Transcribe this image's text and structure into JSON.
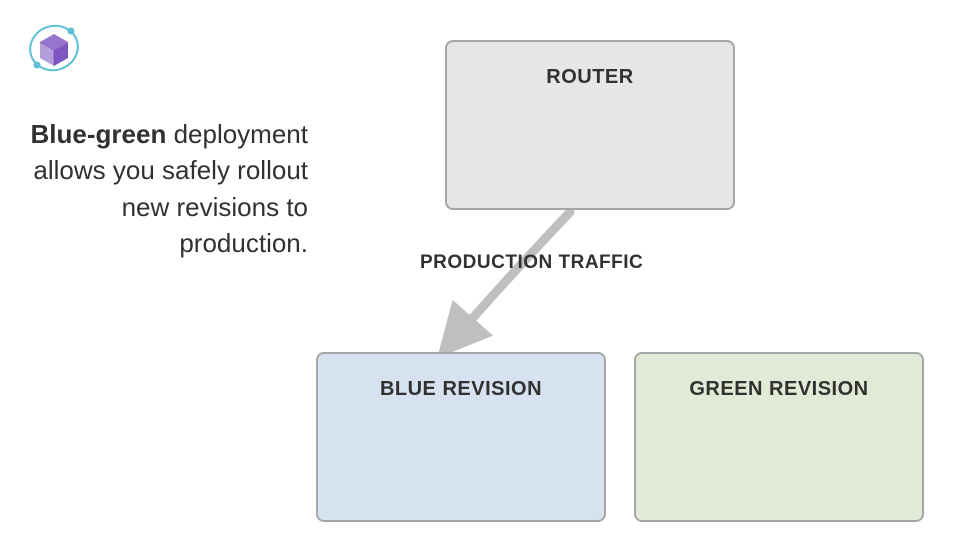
{
  "description": {
    "bold_text": "Blue-green",
    "regular_text": " deployment allows you safely rollout new revisions to production."
  },
  "boxes": {
    "router": "ROUTER",
    "blue": "BLUE REVISION",
    "green": "GREEN REVISION"
  },
  "arrow_label": "PRODUCTION TRAFFIC",
  "colors": {
    "router_bg": "#e6e6e6",
    "blue_bg": "#d7e2f1",
    "green_bg": "#e0ead7",
    "border": "#a6a6a6",
    "arrow": "#bfbfbf"
  }
}
